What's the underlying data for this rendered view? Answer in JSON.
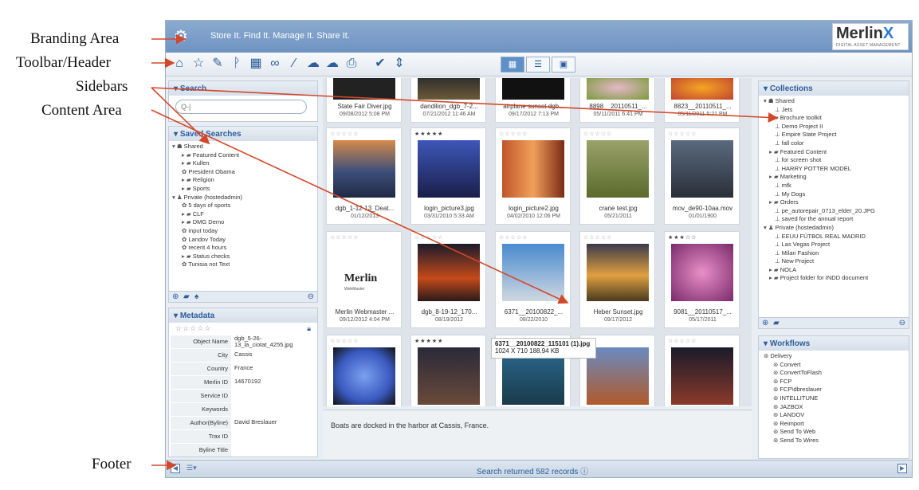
{
  "callouts": {
    "branding": "Branding Area",
    "toolbar": "Toolbar/Header",
    "sidebars": "Sidebars",
    "content": "Content Area",
    "footer": "Footer"
  },
  "brand": {
    "tagline": "Store It. Find It. Manage It. Share It.",
    "logo_word": "Merlin",
    "logo_x": "X",
    "logo_sub": "DIGITAL ASSET MANAGEMENT"
  },
  "search": {
    "title": "Search",
    "placeholder": "Q-|"
  },
  "saved_searches": {
    "title": "Saved Searches",
    "items": [
      "Shared",
      "Featured Content",
      "Kullen",
      "President Obama",
      "Religion",
      "Sports",
      "Private (hostedadmin)",
      "5 days of sports",
      "CLF",
      "DMG Demo",
      "input today",
      "Landov Today",
      "recent 4 hours",
      "Status checks",
      "Tunisia not Text"
    ]
  },
  "metadata": {
    "title": "Metadata",
    "rows": [
      {
        "k": "Object Name",
        "v": "dgb_5-26-13_la_ciotat_4255.jpg"
      },
      {
        "k": "City",
        "v": "Cassis"
      },
      {
        "k": "Country",
        "v": "France"
      },
      {
        "k": "Merlin ID",
        "v": "14670192"
      },
      {
        "k": "Service ID",
        "v": ""
      },
      {
        "k": "Keywords",
        "v": ""
      },
      {
        "k": "Author(Byline)",
        "v": "David Breslauer"
      },
      {
        "k": "Trax ID",
        "v": ""
      },
      {
        "k": "Byline Title",
        "v": ""
      }
    ]
  },
  "top_row": [
    {
      "name": "State Fair Diver.jpg",
      "date": "09/08/2012 5:08 PM"
    },
    {
      "name": "dandilion_dgb_7-2...",
      "date": "07/21/2012 11:46 AM"
    },
    {
      "name": "airplane sunset dgb...",
      "date": "09/17/2012 7:13 PM"
    },
    {
      "name": "8898__20110511_...",
      "date": "05/11/2011 6:41 PM"
    },
    {
      "name": "8823__20110511_...",
      "date": "05/11/2011 5:21 PM"
    }
  ],
  "row1": [
    {
      "stars": "☆☆☆☆☆",
      "name": "dgb_1-12-13_Deat...",
      "date": "01/12/2013"
    },
    {
      "stars": "★★★★★",
      "name": "login_picture3.jpg",
      "date": "03/31/2010 5:33 AM"
    },
    {
      "stars": "☆☆☆☆☆",
      "name": "login_picture2.jpg",
      "date": "04/02/2010 12:06 PM"
    },
    {
      "stars": "☆☆☆☆☆",
      "name": "crane test.jpg",
      "date": "05/21/2011"
    },
    {
      "stars": "☆☆☆☆☆",
      "name": "mov_de90-10aa.mov",
      "date": "01/01/1900"
    }
  ],
  "row2": [
    {
      "stars": "☆☆☆☆☆",
      "name": "Merlin Webmaster ...",
      "date": "09/12/2012 4:04 PM"
    },
    {
      "stars": "☆☆☆☆☆",
      "name": "dgb_8-19-12_170...",
      "date": "08/19/2012"
    },
    {
      "stars": "☆☆☆☆☆",
      "name": "6371__20100822_...",
      "date": "08/22/2010"
    },
    {
      "stars": "☆☆☆☆☆",
      "name": "Heber Sunset.jpg",
      "date": "09/17/2012"
    },
    {
      "stars": "★★★☆☆",
      "name": "9081__20110517_...",
      "date": "05/17/2011"
    }
  ],
  "row3": [
    {
      "stars": "☆☆☆☆☆"
    },
    {
      "stars": "★★★★★"
    },
    {
      "stars": "☆☆☆☆☆"
    },
    {
      "stars": "☆"
    },
    {
      "stars": "☆☆☆☆☆"
    }
  ],
  "merlin_thumb": {
    "word": "Merlin",
    "sub": "WebMaster"
  },
  "tooltip": {
    "line1": "6371__20100822_115101 (1).jpg",
    "line2": "1024 X 710   188.94 KB"
  },
  "caption": "Boats are docked in the harbor at Cassis, France.",
  "collections": {
    "title": "Collections",
    "items": [
      "Shared",
      "Jets",
      "Brochure toolkit",
      "Demo Project II",
      "Empire State Project",
      "fall color",
      "Featured Content",
      "for screen shot",
      "HARRY POTTER MODEL",
      "Marketing",
      "mfk",
      "My Dogs",
      "Orders",
      "pe_autorepair_0713_elder_20.JPG",
      "saved for the annual report",
      "Private (hostedadmin)",
      "EEUU FÚTBOL REAL MADRID",
      "Las Vegas Project",
      "Milan Fashion",
      "New Project",
      "NOLA",
      "Project folder for INDD document"
    ]
  },
  "workflows": {
    "title": "Workflows",
    "items": [
      "Delivery",
      "Convert",
      "ConvertToFlash",
      "FCP",
      "FCP\\dbreslauer",
      "INTELLITUNE",
      "JAZBOX",
      "LANDOV",
      "Reimport",
      "Send To Web",
      "Send To Wires"
    ]
  },
  "footer": {
    "status": "Search returned 582 records"
  },
  "colors": {
    "accent": "#2d5d9c",
    "brand": "#6f93c2",
    "arrow": "#d3482a"
  }
}
